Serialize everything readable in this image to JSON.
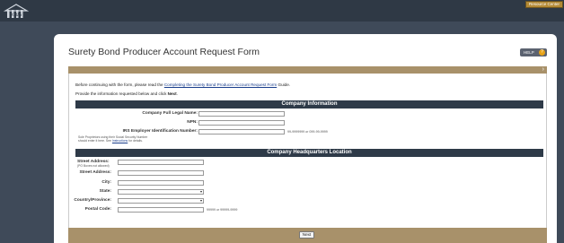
{
  "header": {
    "logo_text": "NMLS",
    "resource_center_label": "Resource Center"
  },
  "page": {
    "title": "Surety Bond Producer Account Request Form",
    "help_label": "HELP",
    "help_icon": "?"
  },
  "intro": {
    "line1_prefix": "Before continuing with the form, please read the",
    "line1_link": "Completing the Surety Bond Producer Account Request Form",
    "line1_suffix": "Guide.",
    "line2_prefix": "Provide the information requested below and click",
    "line2_bold": "Next",
    "line2_suffix": "."
  },
  "company_info": {
    "header": "Company Information",
    "legal_name_label": "Company Full Legal Name:",
    "npn_label": "NPN:",
    "ein_label": "IRS Employer Identification Number:",
    "ein_note_line1": "Sole Proprietors using their Social Security Number",
    "ein_note_line2_prefix": "should enter it here. See",
    "ein_note_link": "Instructions",
    "ein_note_line2_suffix": "for details.",
    "ein_hint": "99-9999999 or 099-99-9999"
  },
  "hq_location": {
    "header": "Company Headquarters Location",
    "street1_label": "Street Address:",
    "street1_sublabel": "(PO Boxes not allowed)",
    "street2_label": "Street Address:",
    "city_label": "City:",
    "state_label": "State:",
    "country_label": "Country/Province:",
    "postal_label": "Postal Code:",
    "postal_hint": "99999 or 99999-9999"
  },
  "footer": {
    "next_label": "Next"
  },
  "colors": {
    "topbar": "#2f3945",
    "background": "#3f4a59",
    "section_header": "#2e3a48",
    "gold_bar": "#a8916a",
    "help_accent": "#e8a317"
  }
}
